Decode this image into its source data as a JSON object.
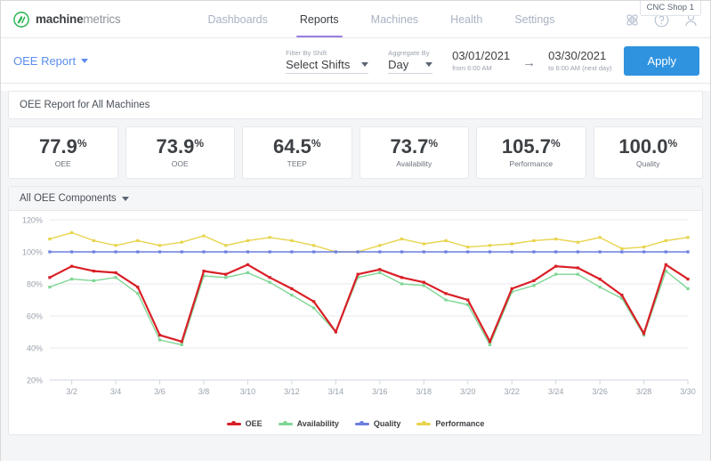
{
  "header": {
    "brand_bold": "machine",
    "brand_light": "metrics",
    "brand_icon": "machinemetrics-logo-icon",
    "shop_chip": "CNC Shop 1",
    "tabs": [
      {
        "label": "Dashboards",
        "active": false
      },
      {
        "label": "Reports",
        "active": true
      },
      {
        "label": "Machines",
        "active": false
      },
      {
        "label": "Health",
        "active": false
      },
      {
        "label": "Settings",
        "active": false
      }
    ],
    "icons": [
      {
        "name": "atom-icon"
      },
      {
        "name": "help-circle-icon"
      },
      {
        "name": "user-account-icon"
      }
    ]
  },
  "filterbar": {
    "report_name": "OEE Report",
    "shift_label": "Filter By Shift",
    "shift_value": "Select Shifts",
    "aggregate_label": "Aggregate By",
    "aggregate_value": "Day",
    "start_date": "03/01/2021",
    "start_sub": "from 6:00 AM",
    "range_arrow": "→",
    "end_date": "03/30/2021",
    "end_sub": "to 6:00 AM (next day)",
    "apply_label": "Apply"
  },
  "panel": {
    "title": "OEE Report for All Machines"
  },
  "kpis": [
    {
      "value": "77.9",
      "unit": "%",
      "label": "OEE"
    },
    {
      "value": "73.9",
      "unit": "%",
      "label": "OOE"
    },
    {
      "value": "64.5",
      "unit": "%",
      "label": "TEEP"
    },
    {
      "value": "73.7",
      "unit": "%",
      "label": "Availability"
    },
    {
      "value": "105.7",
      "unit": "%",
      "label": "Performance"
    },
    {
      "value": "100.0",
      "unit": "%",
      "label": "Quality"
    }
  ],
  "chart_panel": {
    "title": "All OEE Components"
  },
  "chart_data": {
    "type": "line",
    "title": "All OEE Components",
    "xlabel": "",
    "ylabel": "",
    "ylim": [
      20,
      120
    ],
    "yticks": [
      "20%",
      "40%",
      "60%",
      "80%",
      "100%",
      "120%"
    ],
    "grid": true,
    "legend_position": "bottom",
    "x": [
      "3/1",
      "3/2",
      "3/3",
      "3/4",
      "3/5",
      "3/6",
      "3/7",
      "3/8",
      "3/9",
      "3/10",
      "3/11",
      "3/12",
      "3/13",
      "3/14",
      "3/15",
      "3/16",
      "3/17",
      "3/18",
      "3/19",
      "3/20",
      "3/21",
      "3/22",
      "3/23",
      "3/24",
      "3/25",
      "3/26",
      "3/27",
      "3/28",
      "3/29",
      "3/30"
    ],
    "xtick_labels": [
      "3/2",
      "3/4",
      "3/6",
      "3/8",
      "3/10",
      "3/12",
      "3/14",
      "3/16",
      "3/18",
      "3/20",
      "3/22",
      "3/24",
      "3/26",
      "3/28",
      "3/30"
    ],
    "series": [
      {
        "name": "OEE",
        "color": "#d91f26",
        "values": [
          84,
          91,
          88,
          87,
          78,
          48,
          44,
          88,
          86,
          92,
          84,
          77,
          69,
          50,
          86,
          89,
          84,
          81,
          74,
          70,
          44,
          77,
          82,
          91,
          90,
          83,
          73,
          49,
          92,
          83
        ]
      },
      {
        "name": "Availability",
        "color": "#7ed694",
        "values": [
          78,
          83,
          82,
          84,
          74,
          45,
          42,
          85,
          84,
          87,
          81,
          73,
          65,
          50,
          84,
          87,
          80,
          79,
          70,
          67,
          42,
          75,
          79,
          86,
          86,
          78,
          71,
          48,
          88,
          77
        ]
      },
      {
        "name": "Quality",
        "color": "#6b7fe0",
        "values": [
          100,
          100,
          100,
          100,
          100,
          100,
          100,
          100,
          100,
          100,
          100,
          100,
          100,
          100,
          100,
          100,
          100,
          100,
          100,
          100,
          100,
          100,
          100,
          100,
          100,
          100,
          100,
          100,
          100,
          100
        ]
      },
      {
        "name": "Performance",
        "color": "#e8d44d",
        "values": [
          108,
          112,
          107,
          104,
          107,
          104,
          106,
          110,
          104,
          107,
          109,
          107,
          104,
          100,
          100,
          104,
          108,
          105,
          107,
          103,
          104,
          105,
          107,
          108,
          106,
          109,
          102,
          103,
          107,
          109
        ]
      }
    ]
  }
}
